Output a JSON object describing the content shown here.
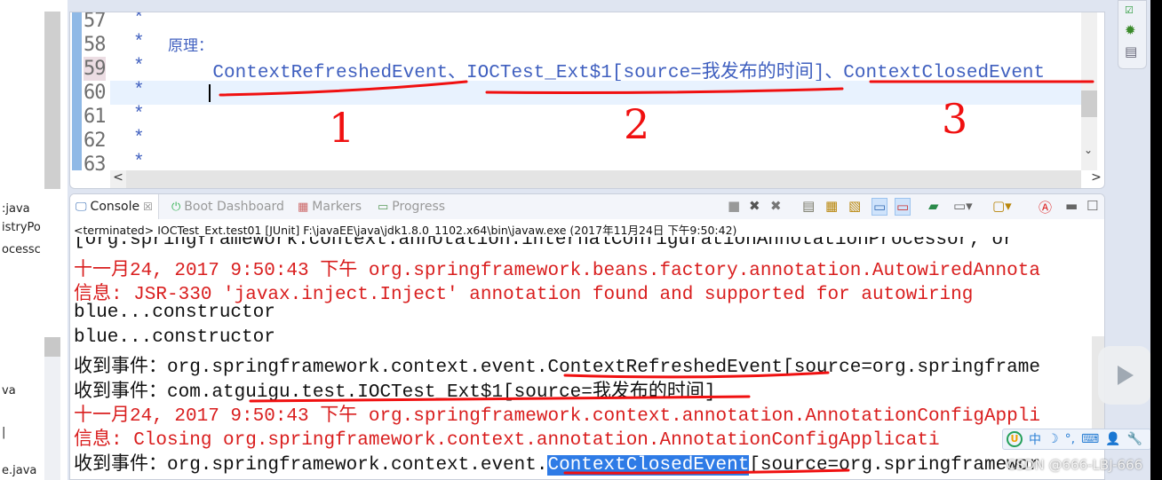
{
  "sidebar": {
    "fragments": [
      ":java",
      "istryPo",
      "ocessc",
      "va",
      "|",
      "e.java"
    ]
  },
  "editor": {
    "line_numbers": [
      "57",
      "58",
      "59",
      "60",
      "61",
      "62",
      "63"
    ],
    "lines": [
      {
        "star": "*",
        "text": ""
      },
      {
        "star": "*",
        "text": "原理："
      },
      {
        "star": "*",
        "text": "    ContextRefreshedEvent、IOCTest_Ext$1[source=我发布的时间]、ContextClosedEvent"
      },
      {
        "star": "*",
        "text": ""
      },
      {
        "star": "*",
        "text": ""
      },
      {
        "star": "*",
        "text": ""
      },
      {
        "star": "*",
        "text": ""
      }
    ],
    "scroll_left": "<",
    "scroll_right": ">",
    "scroll_down": "⌄"
  },
  "annotations": [
    "1",
    "2",
    "3"
  ],
  "console": {
    "tabs": [
      {
        "label": "Console",
        "icon": "console-icon",
        "close": "☒"
      },
      {
        "label": "Boot Dashboard",
        "icon": "boot-dashboard-icon"
      },
      {
        "label": "Markers",
        "icon": "markers-icon"
      },
      {
        "label": "Progress",
        "icon": "progress-icon"
      }
    ],
    "header": "<terminated> IOCTest_Ext.test01 [JUnit] F:\\javaEE\\java\\jdk1.8.0_1102.x64\\bin\\javaw.exe (2017年11月24日 下午9:50:42)",
    "lines": [
      {
        "text": "[org.springframework.context.annotation.internalConfigurationAnnotationProcessor, or",
        "color": "black"
      },
      {
        "text": "十一月24, 2017 9:50:43 下午 org.springframework.beans.factory.annotation.AutowiredAnnota",
        "color": "red"
      },
      {
        "text": "信息: JSR-330 'javax.inject.Inject' annotation found and supported for autowiring",
        "color": "red"
      },
      {
        "text": "blue...constructor",
        "color": "black"
      },
      {
        "text": "blue...constructor",
        "color": "black"
      },
      {
        "text": "收到事件：org.springframework.context.event.ContextRefreshedEvent[source=org.springframe",
        "color": "black"
      },
      {
        "text": "收到事件：com.atguigu.test.IOCTest_Ext$1[source=我发布的时间]",
        "color": "black"
      },
      {
        "text": "十一月24, 2017 9:50:43 下午 org.springframework.context.annotation.AnnotationConfigAppli",
        "color": "red"
      },
      {
        "text": "信息: Closing org.springframework.context.annotation.AnnotationConfigApplicati",
        "color": "red"
      }
    ],
    "last_line": {
      "before": "收到事件：org.springframework.context.event.",
      "selected": "ContextClosedEvent",
      "after": "[source=org.springframewor"
    }
  },
  "ime": {
    "items": [
      "U",
      "中",
      "☽",
      "°,",
      "⌨",
      "👤",
      "🔧"
    ]
  },
  "watermark": "CSDN @666-LBJ-666"
}
